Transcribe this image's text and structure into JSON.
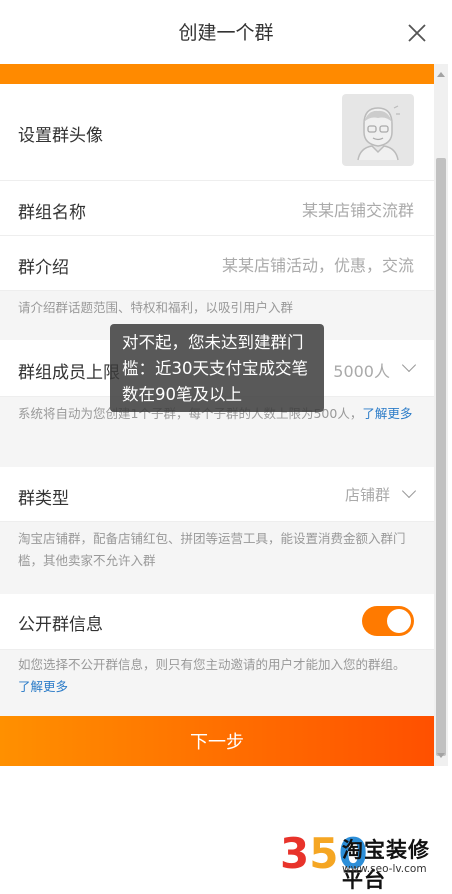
{
  "header": {
    "title": "创建一个群",
    "close_icon": "close-icon"
  },
  "rows": {
    "avatar_label": "设置群头像",
    "name_label": "群组名称",
    "name_placeholder": "某某店铺交流群",
    "intro_label": "群介绍",
    "intro_placeholder": "某某店铺活动，优惠，交流",
    "intro_hint": "请介绍群话题范围、特权和福利，以吸引用户入群",
    "members_label": "群组成员上限",
    "members_value": "5000人",
    "members_hint": "系统将自动为您创建1个子群，每个子群的人数上限为500人，",
    "members_hint_link": "了解更多",
    "type_label": "群类型",
    "type_value": "店铺群",
    "type_hint": "淘宝店铺群，配备店铺红包、拼团等运营工具，能设置消费金额入群门槛，其他卖家不允许入群",
    "public_label": "公开群信息",
    "public_enabled": true,
    "public_hint": "如您选择不公开群信息，则只有您主动邀请的用户才能加入您的群组。",
    "public_hint_link": "了解更多"
  },
  "next_button": "下一步",
  "toast": "对不起，您未达到建群门槛：近30天支付宝成交笔数在90笔及以上",
  "watermark": {
    "digits": "350",
    "text": "淘宝装修平台",
    "url": "www.seo-lv.com"
  },
  "colors": {
    "accent": "#ff7a00",
    "link": "#2c7cc8"
  }
}
